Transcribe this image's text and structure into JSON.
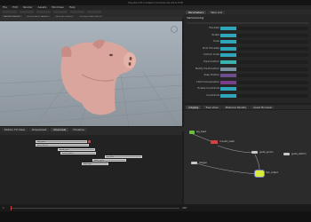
{
  "app": {
    "title": "Houdini FX Limited Commercial 19.0.578"
  },
  "menu": [
    "File",
    "Edit",
    "Render",
    "Assets",
    "Windows",
    "Help"
  ],
  "viewport": {
    "tabs": [
      "Scene View",
      "Animation Editor",
      "Render View",
      "Composite View"
    ]
  },
  "parameters": {
    "tabs": [
      "Parameters",
      "Take List"
    ],
    "node_label": "hairGrooming",
    "rows": [
      "Translate",
      "Rotate",
      "Scale",
      "Pivot Translate",
      "Uniform Scale",
      "Pre-transform",
      "Modify Pre-Transform",
      "Keep Position",
      "Child Compensation",
      "Enable Constraints",
      "Constraints"
    ],
    "bar_colors": [
      "#2fa6b9",
      "#2fa6b9",
      "#2fa6b9",
      "#2fa6b9",
      "#2fa6b9",
      "#3bb4b0",
      "#7a8fa0",
      "#6e4d8c",
      "#7a3f8a",
      "#2fa6b9",
      "#2fa6b9"
    ]
  },
  "network": {
    "tabs": [
      "/obj/pig",
      "Tree View",
      "Material Palette",
      "Asset Browser"
    ],
    "nodes": [
      {
        "name": "pig_head",
        "color": "#67c23a"
      },
      {
        "name": "convert_mesh",
        "color": "#d84040"
      },
      {
        "name": "guide_groom",
        "color": "#c8c8c8"
      },
      {
        "name": "hairgen",
        "color": "#c8c8c8"
      },
      {
        "name": "guide_deform",
        "color": "#c8c8c8"
      },
      {
        "name": "hair_output",
        "color": "#d6ec3a"
      }
    ]
  },
  "timeline": {
    "tabs": [
      "Motion FX View",
      "Dopesheet",
      "Channels",
      "Timeline"
    ],
    "clips": [
      "clip_pose",
      "pose_blend",
      "head_turn",
      "snout_twitch",
      "ear_flick",
      "blink_cycle",
      "idle_loop"
    ]
  },
  "playbar": {
    "frame": "1",
    "end": "240"
  }
}
